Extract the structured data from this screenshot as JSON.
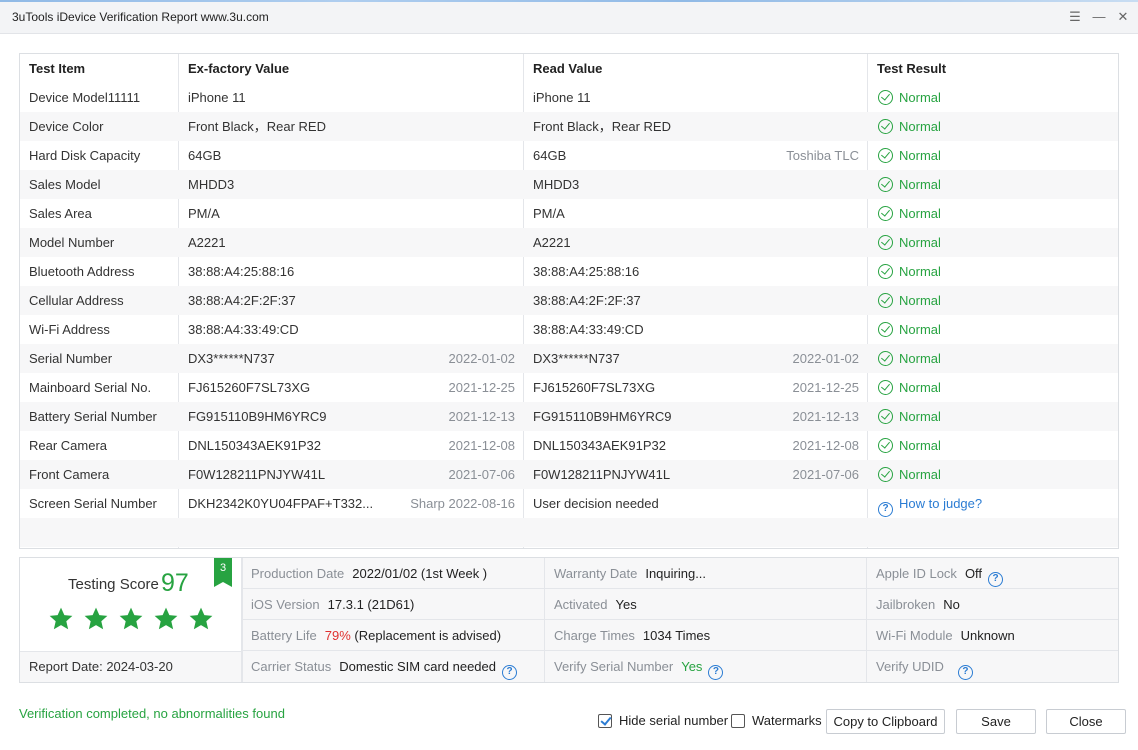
{
  "window": {
    "title": "3uTools iDevice Verification Report www.3u.com",
    "menu_icon": "menu-icon",
    "minimize_icon": "minimize-icon",
    "close_icon": "close-icon"
  },
  "table": {
    "headers": [
      "Test Item",
      "Ex-factory Value",
      "Read Value",
      "Test Result"
    ],
    "rows": [
      {
        "item": "Device Model11111",
        "factory": "iPhone 11",
        "factory_note": "",
        "read": "iPhone 11",
        "read_note": "",
        "result": "Normal",
        "status": "ok"
      },
      {
        "item": "Device Color",
        "factory": "Front Black，Rear RED",
        "factory_note": "",
        "read": "Front Black，Rear RED",
        "read_note": "",
        "result": "Normal",
        "status": "ok"
      },
      {
        "item": "Hard Disk Capacity",
        "factory": "64GB",
        "factory_note": "",
        "read": "64GB",
        "read_note": "Toshiba TLC",
        "result": "Normal",
        "status": "ok"
      },
      {
        "item": "Sales Model",
        "factory": "MHDD3",
        "factory_note": "",
        "read": "MHDD3",
        "read_note": "",
        "result": "Normal",
        "status": "ok"
      },
      {
        "item": "Sales Area",
        "factory": "PM/A",
        "factory_note": "",
        "read": "PM/A",
        "read_note": "",
        "result": "Normal",
        "status": "ok"
      },
      {
        "item": "Model Number",
        "factory": "A2221",
        "factory_note": "",
        "read": "A2221",
        "read_note": "",
        "result": "Normal",
        "status": "ok"
      },
      {
        "item": "Bluetooth Address",
        "factory": "38:88:A4:25:88:16",
        "factory_note": "",
        "read": "38:88:A4:25:88:16",
        "read_note": "",
        "result": "Normal",
        "status": "ok"
      },
      {
        "item": "Cellular Address",
        "factory": "38:88:A4:2F:2F:37",
        "factory_note": "",
        "read": "38:88:A4:2F:2F:37",
        "read_note": "",
        "result": "Normal",
        "status": "ok"
      },
      {
        "item": "Wi-Fi Address",
        "factory": "38:88:A4:33:49:CD",
        "factory_note": "",
        "read": "38:88:A4:33:49:CD",
        "read_note": "",
        "result": "Normal",
        "status": "ok"
      },
      {
        "item": "Serial Number",
        "factory": "DX3******N737",
        "factory_note": "2022-01-02",
        "read": "DX3******N737",
        "read_note": "2022-01-02",
        "result": "Normal",
        "status": "ok"
      },
      {
        "item": "Mainboard Serial No.",
        "factory": "FJ615260F7SL73XG",
        "factory_note": "2021-12-25",
        "read": "FJ615260F7SL73XG",
        "read_note": "2021-12-25",
        "result": "Normal",
        "status": "ok"
      },
      {
        "item": "Battery Serial Number",
        "factory": "FG915110B9HM6YRC9",
        "factory_note": "2021-12-13",
        "read": "FG915110B9HM6YRC9",
        "read_note": "2021-12-13",
        "result": "Normal",
        "status": "ok"
      },
      {
        "item": "Rear Camera",
        "factory": "DNL150343AEK91P32",
        "factory_note": "2021-12-08",
        "read": "DNL150343AEK91P32",
        "read_note": "2021-12-08",
        "result": "Normal",
        "status": "ok"
      },
      {
        "item": "Front Camera",
        "factory": "F0W128211PNJYW41L",
        "factory_note": "2021-07-06",
        "read": "F0W128211PNJYW41L",
        "read_note": "2021-07-06",
        "result": "Normal",
        "status": "ok"
      },
      {
        "item": "Screen Serial Number",
        "factory": "DKH2342K0YU04FPAF+T332...",
        "factory_note": "Sharp 2022-08-16",
        "read": "User decision needed",
        "read_note": "",
        "result": "How to judge?",
        "status": "help"
      }
    ]
  },
  "summary": {
    "score_label": "Testing Score",
    "score": "97",
    "badge": "3",
    "stars": 5,
    "star_color": "#27a341",
    "report_date": "Report Date:  2024-03-20",
    "fields": [
      [
        {
          "label": "Production Date",
          "value": "2022/01/02 (1st Week )",
          "tone": "normal",
          "help": false
        },
        {
          "label": "Warranty Date",
          "value": "Inquiring...",
          "tone": "normal",
          "help": false
        },
        {
          "label": "Apple ID Lock",
          "value": "Off",
          "tone": "normal",
          "help": true
        }
      ],
      [
        {
          "label": "iOS Version",
          "value": "17.3.1 (21D61)",
          "tone": "normal",
          "help": false
        },
        {
          "label": "Activated",
          "value": "Yes",
          "tone": "normal",
          "help": false
        },
        {
          "label": "Jailbroken",
          "value": "No",
          "tone": "normal",
          "help": false
        }
      ],
      [
        {
          "label": "Battery Life",
          "value": "79%",
          "value_suffix": " (Replacement is advised)",
          "tone": "red",
          "help": false
        },
        {
          "label": "Charge Times",
          "value": "1034 Times",
          "tone": "normal",
          "help": false
        },
        {
          "label": "Wi-Fi Module",
          "value": "Unknown",
          "tone": "normal",
          "help": false
        }
      ],
      [
        {
          "label": "Carrier Status",
          "value": "Domestic SIM card needed",
          "tone": "normal",
          "help": true
        },
        {
          "label": "Verify Serial Number",
          "value": "Yes",
          "tone": "green",
          "help": true
        },
        {
          "label": "Verify UDID",
          "value": "",
          "tone": "normal",
          "help": true
        }
      ]
    ]
  },
  "footer": {
    "status": "Verification completed, no abnormalities found",
    "hide_serial_label": "Hide serial number",
    "hide_serial_checked": true,
    "watermarks_label": "Watermarks",
    "watermarks_checked": false,
    "copy_label": "Copy to Clipboard",
    "save_label": "Save",
    "close_label": "Close"
  },
  "colors": {
    "accent_green": "#27a341",
    "link_blue": "#2b7cd3",
    "warn_red": "#e0312f"
  }
}
